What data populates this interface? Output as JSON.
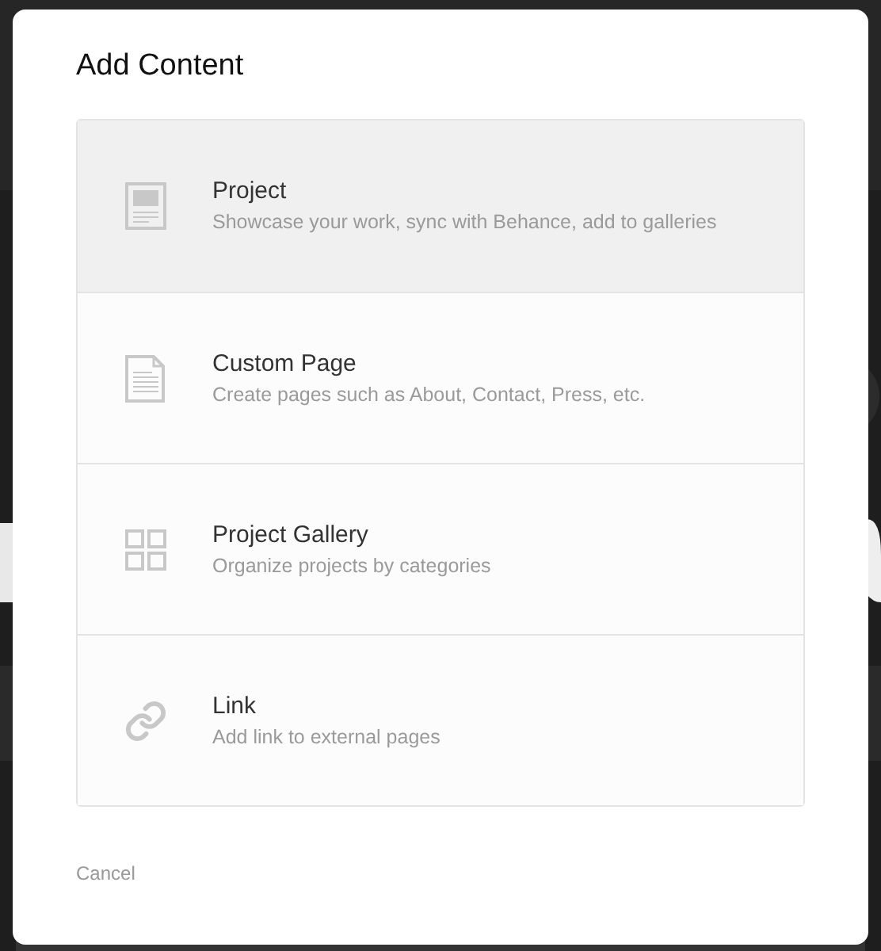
{
  "dialog": {
    "title": "Add Content",
    "options": [
      {
        "kind": "project",
        "title": "Project",
        "description": "Showcase your work, sync with Behance, add to galleries",
        "selected": true
      },
      {
        "kind": "page",
        "title": "Custom Page",
        "description": "Create pages such as About, Contact, Press, etc.",
        "selected": false
      },
      {
        "kind": "gallery",
        "title": "Project Gallery",
        "description": "Organize projects by categories",
        "selected": false
      },
      {
        "kind": "link",
        "title": "Link",
        "description": "Add link to external pages",
        "selected": false
      }
    ],
    "cancel": "Cancel"
  }
}
